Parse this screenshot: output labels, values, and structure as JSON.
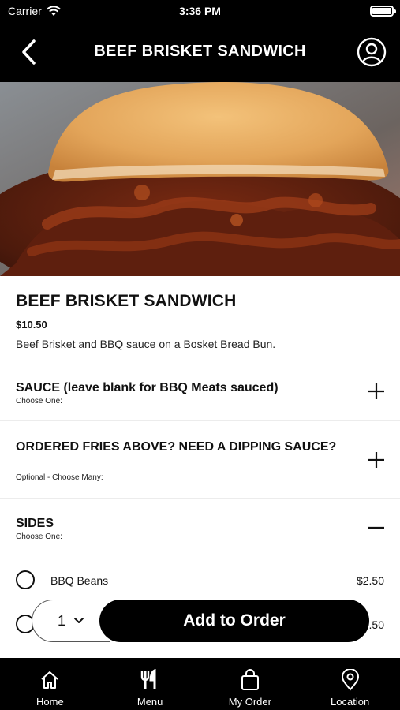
{
  "status_bar": {
    "carrier": "Carrier",
    "time": "3:36 PM"
  },
  "header": {
    "title": "BEEF BRISKET SANDWICH"
  },
  "item": {
    "name": "BEEF BRISKET SANDWICH",
    "price": "$10.50",
    "description": "Beef Brisket and BBQ sauce on a Bosket Bread Bun."
  },
  "sections": [
    {
      "title": "SAUCE (leave blank for BBQ Meats sauced)",
      "subtitle": "Choose One:",
      "expanded": false
    },
    {
      "title": "ORDERED FRIES ABOVE? NEED A DIPPING SAUCE?",
      "subtitle": "Optional - Choose Many:",
      "expanded": false
    },
    {
      "title": "SIDES",
      "subtitle": "Choose One:",
      "expanded": true
    }
  ],
  "sides_options": [
    {
      "label": "BBQ Beans",
      "price": "$2.50"
    },
    {
      "label": "",
      "price": "$2.50"
    }
  ],
  "order_bar": {
    "quantity": "1",
    "add_label": "Add to Order"
  },
  "tabs": [
    {
      "label": "Home",
      "icon": "home-icon"
    },
    {
      "label": "Menu",
      "icon": "fork-knife-icon"
    },
    {
      "label": "My Order",
      "icon": "shopping-bag-icon"
    },
    {
      "label": "Location",
      "icon": "location-pin-icon"
    }
  ]
}
